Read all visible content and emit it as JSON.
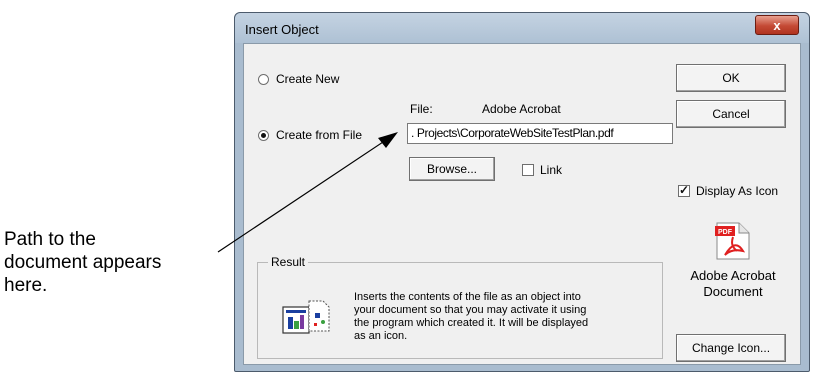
{
  "callout": {
    "lines": [
      "Path to the",
      "document appears",
      "here."
    ]
  },
  "dialog": {
    "title": "Insert Object",
    "close_glyph": "x",
    "options": {
      "create_new": "Create New",
      "create_from_file": "Create from File"
    },
    "file_label": "File:",
    "file_type": "Adobe Acrobat",
    "file_path": ". Projects\\CorporateWebSiteTestPlan.pdf",
    "browse_label": "Browse...",
    "link_label": "Link",
    "link_checked": false,
    "ok_label": "OK",
    "cancel_label": "Cancel",
    "display_as_icon_label": "Display As Icon",
    "display_as_icon_checked": true,
    "icon_caption_lines": [
      "Adobe Acrobat",
      "Document"
    ],
    "change_icon_label": "Change Icon...",
    "result": {
      "legend": "Result",
      "text_lines": [
        "Inserts the contents of the file as an object into",
        "your document so that you may activate it using",
        "the program which created it. It will be displayed",
        "as an icon."
      ]
    },
    "icons": {
      "pdf": "acrobat-pdf-icon",
      "result": "object-package-icon",
      "pdf_badge": "PDF"
    },
    "colors": {
      "frame": "#a9bccf",
      "client": "#f0f0f0",
      "close": "#c44a35",
      "pdf_red": "#e02020"
    }
  }
}
